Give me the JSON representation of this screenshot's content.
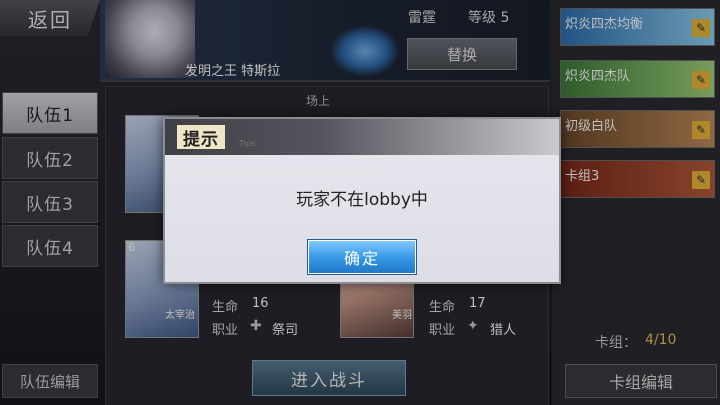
{
  "header": {
    "back_label": "返回",
    "hero_name": "发明之王 特斯拉",
    "player_name": "雷霆",
    "level_text": "等级 5",
    "swap_label": "替换"
  },
  "tabs": [
    {
      "label": "队伍1",
      "active": true
    },
    {
      "label": "队伍2",
      "active": false
    },
    {
      "label": "队伍3",
      "active": false
    },
    {
      "label": "队伍4",
      "active": false
    }
  ],
  "team_edit_label": "队伍编辑",
  "field": {
    "title": "场上",
    "units": [
      {
        "hp_label": "生命",
        "hp": "16",
        "role_label": "职业",
        "role": "祭司",
        "card_name": "太宰治",
        "cost": "6"
      },
      {
        "hp_label": "生命",
        "hp": "17",
        "role_label": "职业",
        "role": "猎人",
        "card_name": "美羽",
        "cost": ""
      }
    ],
    "fight_label": "进入战斗"
  },
  "decks": [
    {
      "name": "炽炎四杰均衡"
    },
    {
      "name": "炽炎四杰队"
    },
    {
      "name": "初级白队"
    },
    {
      "name": "卡组3"
    }
  ],
  "deck_count_label": "卡组：",
  "deck_count_value": "4/10",
  "deck_edit_label": "卡组编辑",
  "modal": {
    "title": "提示",
    "title_en": "Tips",
    "message": "玩家不在lobby中",
    "ok_label": "确定"
  },
  "colors": {
    "ok_button": "#3a9ae6",
    "modal_bg": "#e2e2ea",
    "deck_edit_icon": "#e8b63a"
  }
}
